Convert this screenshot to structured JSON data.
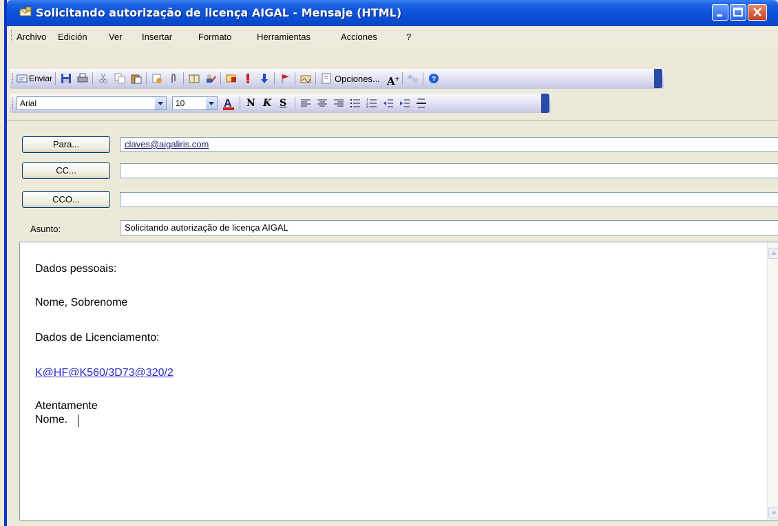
{
  "window": {
    "title": "Solicitando autorização de licença AIGAL - Mensaje (HTML)",
    "controls": [
      "minimize-icon",
      "maximize-icon",
      "close-icon"
    ]
  },
  "menu": [
    "Archivo",
    "Edición",
    "Ver",
    "Insertar",
    "Formato",
    "Herramientas",
    "Acciones",
    "?"
  ],
  "toolbar": {
    "send_label": "Enviar",
    "options_label": "Opciones...",
    "icons": [
      "save-icon",
      "print-icon",
      "cut-icon",
      "copy-icon",
      "paste-icon",
      "permission-icon",
      "attach-icon",
      "address-book-icon",
      "check-names-icon",
      "message-flag-icon",
      "importance-high-icon",
      "importance-low-icon",
      "flag-icon",
      "signature-icon",
      "options-icon",
      "font-size-icon",
      "encoding-icon",
      "help-icon"
    ]
  },
  "format_bar": {
    "font": "Arial",
    "size": "10",
    "icons": [
      "font-color-icon",
      "bold-icon",
      "italic-icon",
      "underline-icon",
      "align-left-icon",
      "center-icon",
      "align-right-icon",
      "bullets-icon",
      "numbering-icon",
      "decrease-indent-icon",
      "increase-indent-icon",
      "horizontal-line-icon"
    ]
  },
  "header": {
    "to_label": "Para...",
    "to_value": "claves@aigaliris.com",
    "cc_label": "CC...",
    "cc_value": "",
    "bcc_label": "CCO...",
    "bcc_value": "",
    "subject_label": "Asunto:",
    "subject_value": "Solicitando autorização de licença AIGAL"
  },
  "body": {
    "line1": "Dados pessoais:",
    "line2": "Nome, Sobrenome",
    "line3": "Dados de Licenciamento:",
    "link": "K@HF@K560/3D73@320/2",
    "line4": "Atentamente",
    "line5": "Nome."
  },
  "colors": {
    "title_bar": "#0a4fd8",
    "link": "#2a2ac8",
    "accent_red": "#d02020"
  }
}
